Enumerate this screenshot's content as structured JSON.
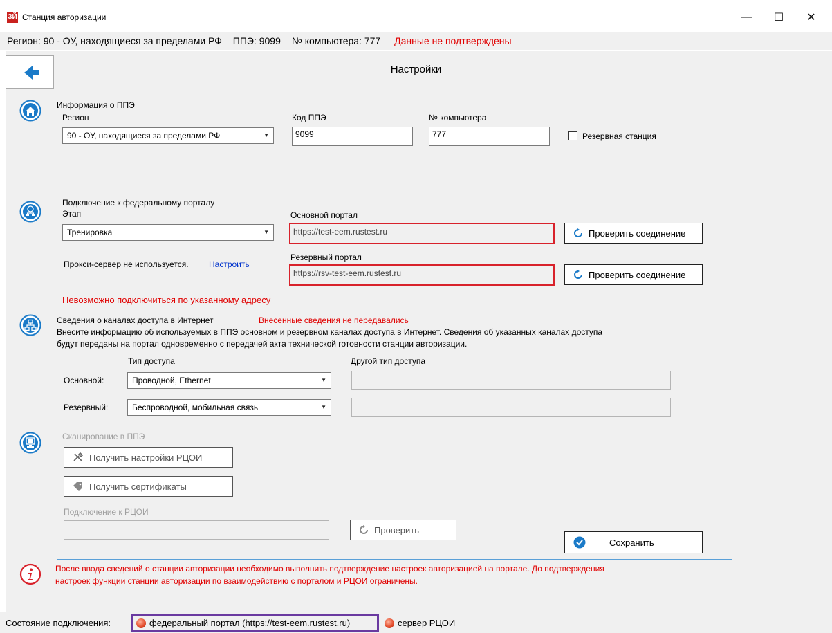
{
  "window": {
    "title": "Станция авторизации",
    "icon_text": "ЗЙ",
    "minimize": "—",
    "maximize": "☐",
    "close": "✕"
  },
  "infobar": {
    "region": "Регион: 90 - ОУ, находящиеся за пределами РФ",
    "ppe": "ППЭ: 9099",
    "computer": "№ компьютера: 777",
    "warning": "Данные не подтверждены"
  },
  "header": {
    "title": "Настройки"
  },
  "ppe_info": {
    "section_title": "Информация о ППЭ",
    "region_label": "Регион",
    "region_value": "90 - ОУ, находящиеся за пределами РФ",
    "code_label": "Код ППЭ",
    "code_value": "9099",
    "computer_label": "№ компьютера",
    "computer_value": "777",
    "reserve_label": "Резервная станция"
  },
  "portal": {
    "section_title": "Подключение к федеральному порталу",
    "stage_label": "Этап",
    "stage_value": "Тренировка",
    "proxy_text": "Прокси-сервер не используется.",
    "proxy_link": "Настроить",
    "main_label": "Основной портал",
    "main_value": "https://test-eem.rustest.ru",
    "reserve_label": "Резервный портал",
    "reserve_value": "https://rsv-test-eem.rustest.ru",
    "check_label": "Проверить соединение",
    "error": "Невозможно подключиться по указанному адресу"
  },
  "channels": {
    "section_title": "Сведения о каналах доступа в Интернет",
    "status": "Внесенные сведения не передавались",
    "desc1": "Внесите информацию  об используемых в ППЭ основном и резервном каналах доступа в Интернет. Сведения об указанных каналах доступа",
    "desc2": "будут переданы на портал одновременно с передачей акта технической готовности станции авторизации.",
    "type_label": "Тип доступа",
    "other_label": "Другой тип доступа",
    "main_label": "Основной:",
    "main_value": "Проводной, Ethernet",
    "reserve_label": "Резервный:",
    "reserve_value": "Беспроводной, мобильная связь"
  },
  "scan": {
    "section_title": "Сканирование в ППЭ",
    "get_settings": "Получить настройки РЦОИ",
    "get_certs": "Получить сертификаты",
    "rcoi_label": "Подключение к РЦОИ",
    "check": "Проверить",
    "save": "Сохранить"
  },
  "notice": {
    "line1": "После ввода сведений о станции авторизации необходимо выполнить подтверждение настроек авторизацией на портале. До подтверждения",
    "line2": "настроек функции станции авторизации по взаимодействию с порталом и РЦОИ ограничены."
  },
  "status": {
    "label": "Состояние подключения:",
    "portal": "федеральный портал (https://test-eem.rustest.ru)",
    "rcoi": "сервер РЦОИ"
  },
  "colors": {
    "accent": "#1a7ac8",
    "error": "#e00000",
    "error_border": "#d8222b",
    "status_highlight": "#6a3aa0"
  }
}
